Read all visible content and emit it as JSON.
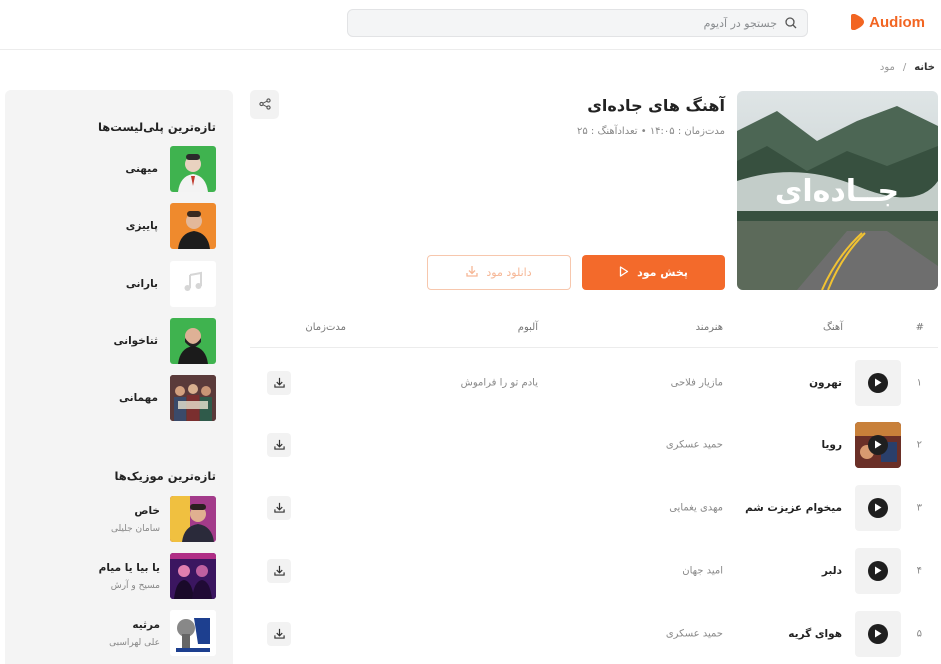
{
  "brand": {
    "name": "Audiom",
    "color": "#f26522"
  },
  "search": {
    "placeholder": "جستجو در آدیوم",
    "icon": "search-icon"
  },
  "breadcrumb": {
    "home": "خانه",
    "separator": "/",
    "current": "مود"
  },
  "sidebar": {
    "playlists_title": "تازه‌ترین پلی‌لیست‌ها",
    "playlists": [
      {
        "label": "میهنی"
      },
      {
        "label": "پاییزی"
      },
      {
        "label": "بارانی"
      },
      {
        "label": "ثناخوانی"
      },
      {
        "label": "مهمانی"
      }
    ],
    "music_title": "تازه‌ترین موزیک‌ها",
    "music": [
      {
        "title": "خاص",
        "artist": "سامان جلیلی"
      },
      {
        "title": "یا بیا یا میام",
        "artist": "مسیح و آرش"
      },
      {
        "title": "مرثیه",
        "artist": "علی لهراسبی"
      }
    ]
  },
  "mood": {
    "title": "آهنگ های جاده‌ای",
    "meta": "مدت‌زمان : ۱۴:۰۵  •  تعدادآهنگ : ۲۵",
    "cover_text": "جــاده‌ای",
    "play_label": "پخش مود",
    "download_label": "دانلود مود"
  },
  "table": {
    "headers": {
      "num": "#",
      "song": "آهنگ",
      "artist": "هنرمند",
      "album": "آلبوم",
      "duration": "مدت‌زمان"
    },
    "rows": [
      {
        "num": "۱",
        "song": "تهرون",
        "artist": "مازیار فلاحی",
        "album": "یادم تو را فراموش"
      },
      {
        "num": "۲",
        "song": "رویا",
        "artist": "حمید عسکری",
        "album": ""
      },
      {
        "num": "۳",
        "song": "میخوام عزیزت شم",
        "artist": "مهدی یغمایی",
        "album": ""
      },
      {
        "num": "۴",
        "song": "دلبر",
        "artist": "امید جهان",
        "album": ""
      },
      {
        "num": "۵",
        "song": "هوای گریه",
        "artist": "حمید عسکری",
        "album": ""
      }
    ]
  }
}
